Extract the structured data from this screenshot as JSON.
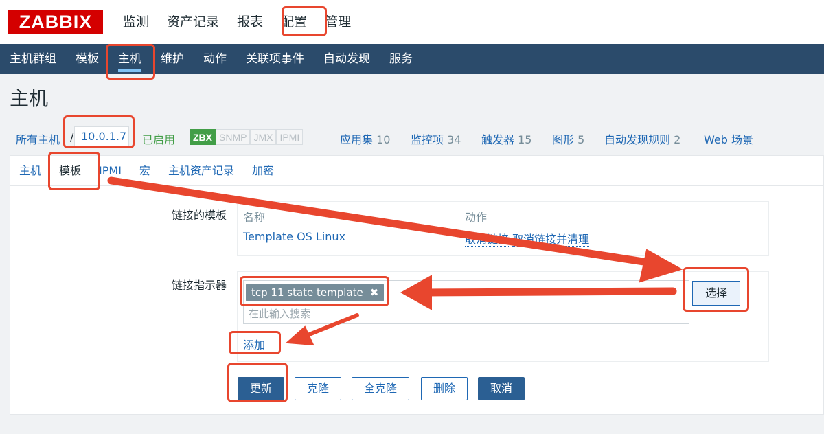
{
  "brand": {
    "logo": "ZABBIX"
  },
  "main_menu": [
    "监测",
    "资产记录",
    "报表",
    "配置",
    "管理"
  ],
  "sub_menu": [
    "主机群组",
    "模板",
    "主机",
    "维护",
    "动作",
    "关联项事件",
    "自动发现",
    "服务"
  ],
  "page": {
    "title": "主机"
  },
  "host_bar": {
    "all_hosts": "所有主机",
    "separator": "/",
    "host": "10.0.1.7",
    "status": "已启用",
    "availability": [
      "ZBX",
      "SNMP",
      "JMX",
      "IPMI"
    ],
    "links": [
      {
        "label": "应用集",
        "count": "10"
      },
      {
        "label": "监控项",
        "count": "34"
      },
      {
        "label": "触发器",
        "count": "15"
      },
      {
        "label": "图形",
        "count": "5"
      },
      {
        "label": "自动发现规则",
        "count": "2"
      },
      {
        "label": "Web 场景",
        "count": ""
      }
    ]
  },
  "tabs": [
    "主机",
    "模板",
    "IPMI",
    "宏",
    "主机资产记录",
    "加密"
  ],
  "linked_templates": {
    "label": "链接的模板",
    "col_name": "名称",
    "col_action": "动作",
    "rows": [
      {
        "name": "Template OS Linux",
        "unlink": "取消链接",
        "unlink_clear": "取消链接并清理"
      }
    ]
  },
  "link_indicator": {
    "label": "链接指示器",
    "chip": "tcp 11 state template",
    "chip_remove": "✖",
    "placeholder": "在此输入搜索",
    "select_button": "选择",
    "add_link": "添加"
  },
  "buttons": {
    "update": "更新",
    "clone": "克隆",
    "full_clone": "全克隆",
    "delete": "删除",
    "cancel": "取消"
  },
  "colors": {
    "brand_red": "#d40000",
    "nav_blue": "#2b4b6b",
    "link": "#1f68b4",
    "annotation": "#e8462e",
    "enabled_green": "#429e47"
  }
}
